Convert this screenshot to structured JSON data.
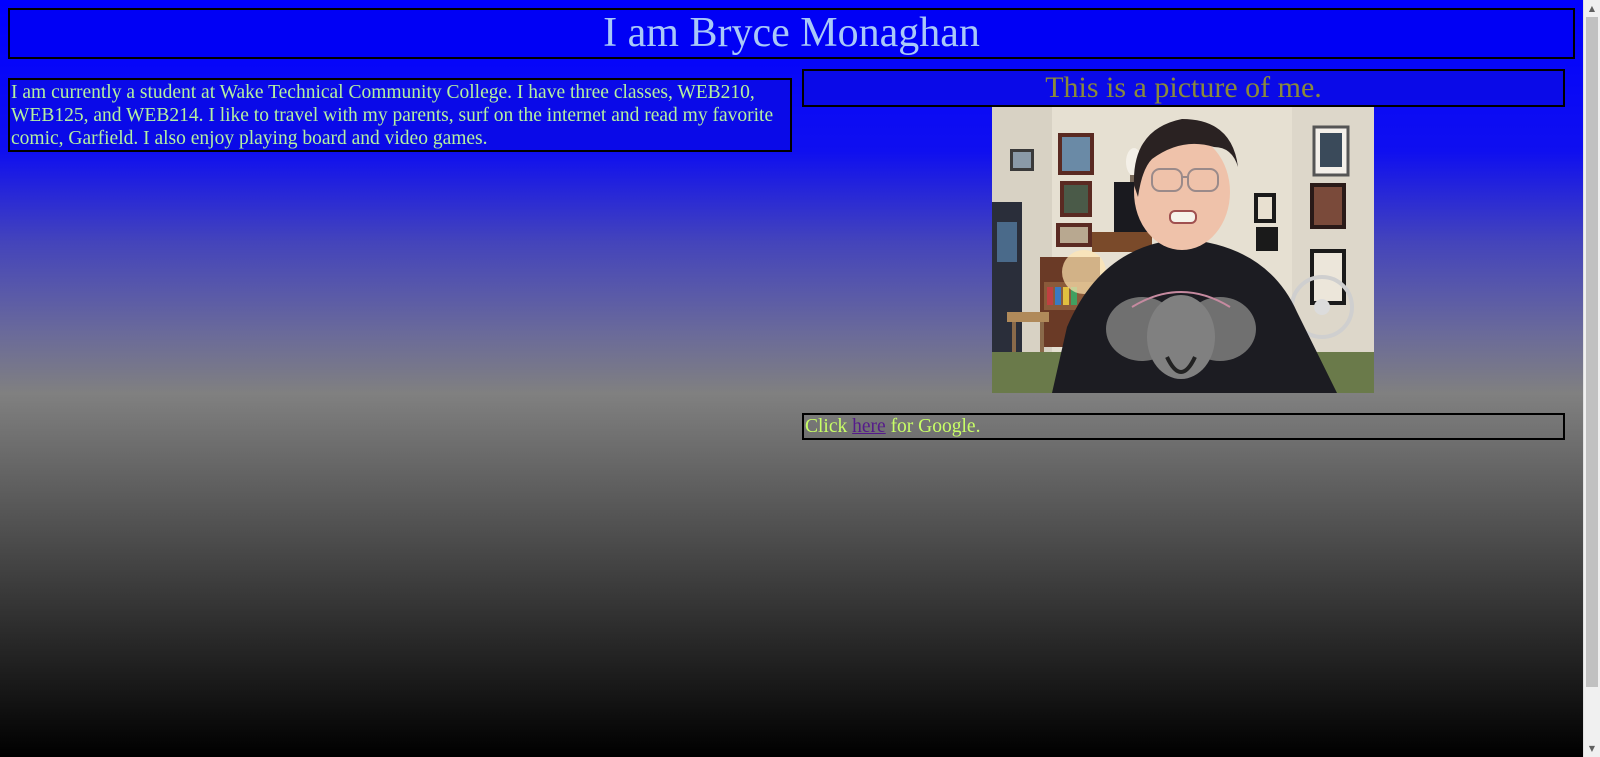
{
  "header": {
    "title": "I am Bryce Monaghan"
  },
  "bio": {
    "text": "I am currently a student at Wake Technical Community College. I have three classes, WEB210, WEB125, and WEB214. I like to travel with my parents, surf on the internet and read my favorite comic, Garfield. I also enjoy playing board and video games."
  },
  "photo_section": {
    "caption": "This is a picture of me."
  },
  "link_section": {
    "prefix": "Click",
    "link_text": "here",
    "suffix": "for Google."
  },
  "scrollbar": {
    "up_icon": "▲",
    "down_icon": "▼"
  },
  "colors": {
    "header_background": "#0000f5",
    "header_text": "#a8c8f8",
    "body_text": "#b4f0a0",
    "caption_text": "#8a8a3a",
    "link_line_text": "#c8ff66",
    "link_color": "#551a8b"
  }
}
